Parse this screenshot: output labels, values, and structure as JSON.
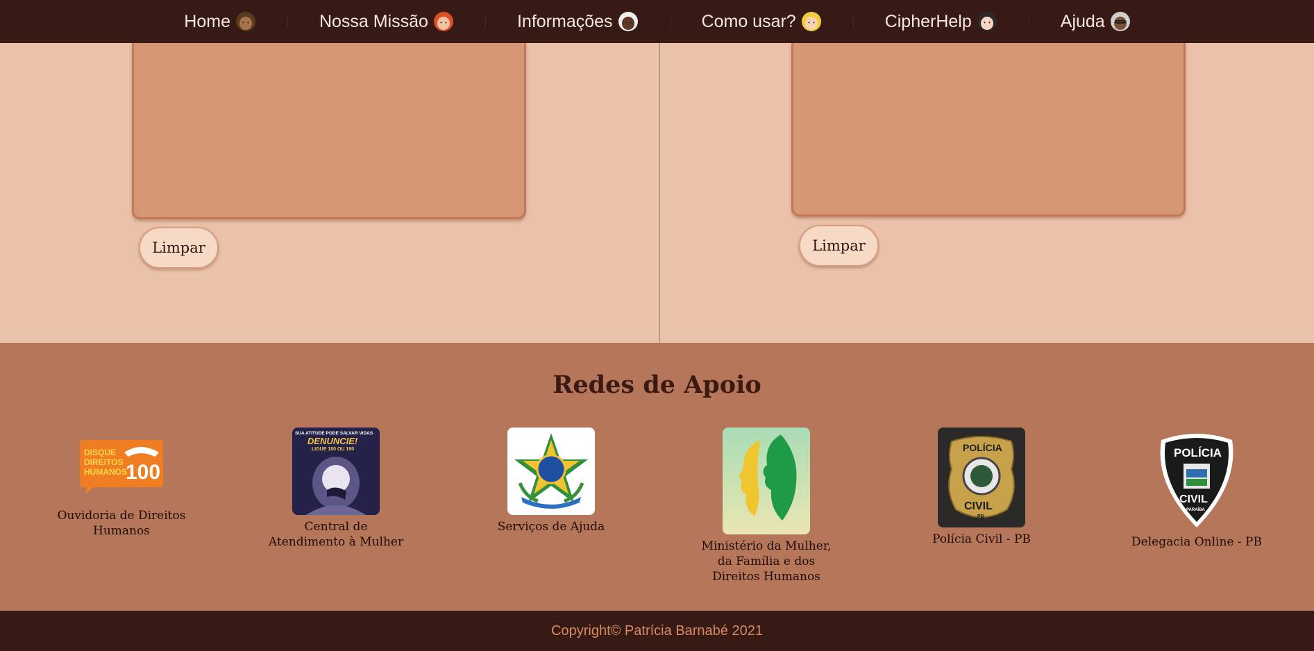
{
  "nav": {
    "items": [
      {
        "label": "Home",
        "icon": "woman-medium-dark-skin-icon"
      },
      {
        "label": "Nossa Missão",
        "icon": "woman-red-hair-icon"
      },
      {
        "label": "Informações",
        "icon": "woman-white-hair-dark-skin-icon"
      },
      {
        "label": "Como usar?",
        "icon": "woman-blonde-icon"
      },
      {
        "label": "CipherHelp",
        "icon": "woman-dark-hair-icon"
      },
      {
        "label": "Ajuda",
        "icon": "old-woman-glasses-icon"
      }
    ]
  },
  "main": {
    "left_clear_label": "Limpar",
    "right_clear_label": "Limpar"
  },
  "support": {
    "title": "Redes de Apoio",
    "cards": [
      {
        "label": "Ouvidoria de Direitos Humanos",
        "logo_lines": [
          "DISQUE",
          "DIREITOS",
          "HUMANOS"
        ],
        "logo_number": "100"
      },
      {
        "label": "Central de Atendimento à Mulher",
        "logo_top": "SUA ATITUDE PODE SALVAR VIDAS",
        "logo_main": "DENUNCIE!",
        "logo_sub": "LIGUE 180 OU 190"
      },
      {
        "label": "Serviços de Ajuda"
      },
      {
        "label": "Ministério da Mulher, da Família e dos Direitos Humanos"
      },
      {
        "label": "Polícia Civil - PB",
        "logo_top": "POLÍCIA",
        "logo_bottom": "CIVIL",
        "logo_small": "PB"
      },
      {
        "label": "Delegacia Online - PB",
        "logo_top": "POLÍCIA",
        "logo_bottom": "CIVIL",
        "logo_small": "PARAÍBA"
      }
    ]
  },
  "footer": {
    "copyright": "Copyright© Patrícia Barnabé 2021"
  },
  "colors": {
    "nav_bg": "#371a14",
    "main_bg": "#eac2a9",
    "textbox_bg": "#d49673",
    "support_bg": "#b57659",
    "footer_text": "#d88a64"
  }
}
